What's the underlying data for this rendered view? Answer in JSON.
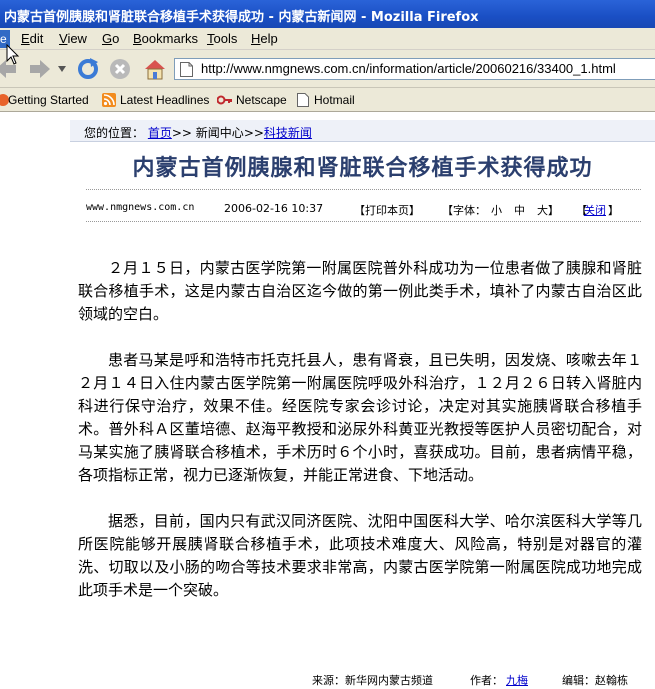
{
  "window": {
    "title": "内蒙古首例胰腺和肾脏联合移植手术获得成功 - 内蒙古新闻网 - Mozilla Firefox"
  },
  "menu": [
    "Edit",
    "View",
    "Go",
    "Bookmarks",
    "Tools",
    "Help"
  ],
  "menu_file_stub": "e",
  "address": {
    "url": "http://www.nmgnews.com.cn/information/article/20060216/33400_1.html"
  },
  "bookmarks": [
    "Getting Started",
    "Latest Headlines",
    "Netscape",
    "Hotmail"
  ],
  "breadcrumb": {
    "prefix": "您的位置：",
    "home": "首页",
    "sep1": ">>",
    "center": "新闻中心",
    "sep2": ">>",
    "category": "科技新闻"
  },
  "article": {
    "headline": "内蒙古首例胰腺和肾脏联合移植手术获得成功",
    "site": "www.nmgnews.com.cn",
    "datetime": "2006-02-16 10:37",
    "print": "【打印本页】",
    "font_label": "【字体：",
    "font_small": "小",
    "font_medium": "中",
    "font_large": "大】",
    "close_open": "【",
    "close": "关闭",
    "close_close": "】",
    "paragraphs": [
      "２月１５日，内蒙古医学院第一附属医院普外科成功为一位患者做了胰腺和肾脏联合移植手术，这是内蒙古自治区迄今做的第一例此类手术，填补了内蒙古自治区此领域的空白。",
      "患者马某是呼和浩特市托克托县人，患有肾衰，且已失明，因发烧、咳嗽去年１２月１４日入住内蒙古医学院第一附属医院呼吸外科治疗，１２月２６日转入肾脏内科进行保守治疗，效果不佳。经医院专家会诊讨论，决定对其实施胰肾联合移植手术。普外科Ａ区董培德、赵海平教授和泌尿外科黄亚光教授等医护人员密切配合，对马某实施了胰肾联合移植术，手术历时６个小时，喜获成功。目前，患者病情平稳，各项指标正常，视力已逐渐恢复，并能正常进食、下地活动。",
      "据悉，目前，国内只有武汉同济医院、沈阳中国医科大学、哈尔滨医科大学等几所医院能够开展胰肾联合移植手术，此项技术难度大、风险高，特别是对器官的灌洗、切取以及小肠的吻合等技术要求非常高，内蒙古医学院第一附属医院成功地完成此项手术是一个突破。"
    ],
    "source": "来源：新华网内蒙古频道",
    "author_label": "作者：",
    "author": "九梅",
    "editor": "编辑：赵翰栋"
  },
  "colors": {
    "titlebar": "#1a4fc4",
    "chrome": "#ece9d8",
    "link": "#0000cc",
    "headline": "#2b3f6e"
  }
}
